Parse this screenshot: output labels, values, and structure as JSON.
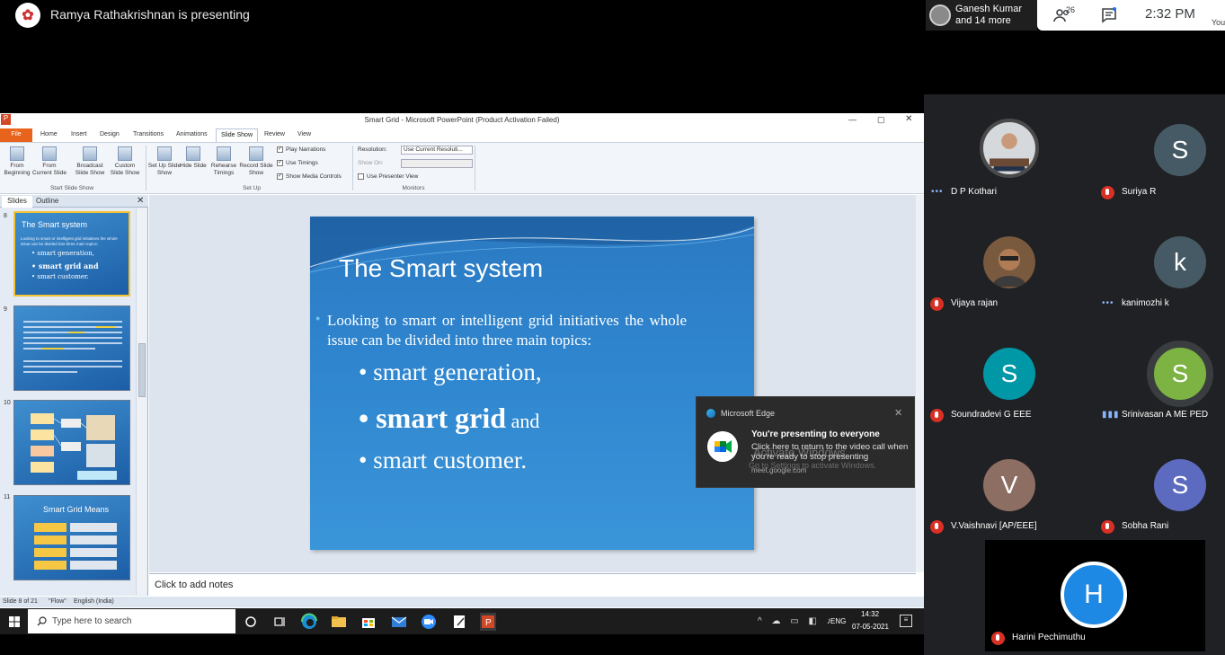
{
  "meet": {
    "presenter_text": "Ramya Rathakrishnan is presenting",
    "chip_line1": "Ganesh Kumar",
    "chip_line2": "and 14 more",
    "people_count": "26",
    "clock": "2:32 PM",
    "you_label": "You"
  },
  "powerpoint": {
    "title": "Smart Grid - Microsoft PowerPoint (Product Activation Failed)",
    "menu": [
      "File",
      "Home",
      "Insert",
      "Design",
      "Transitions",
      "Animations",
      "Slide Show",
      "Review",
      "View"
    ],
    "ribbon": {
      "from_beginning": "From Beginning",
      "from_current": "From Current Slide",
      "broadcast": "Broadcast Slide Show",
      "custom": "Custom Slide Show",
      "group_start": "Start Slide Show",
      "setup": "Set Up Slide Show",
      "hide": "Hide Slide",
      "rehearse": "Rehearse Timings",
      "record": "Record Slide Show",
      "group_setup": "Set Up",
      "play_narrations": "Play Narrations",
      "use_timings": "Use Timings",
      "show_media": "Show Media Controls",
      "resolution_label": "Resolution:",
      "resolution_value": "Use Current Resoluti...",
      "show_on": "Show On:",
      "presenter_view": "Use Presenter View",
      "group_monitors": "Monitors"
    },
    "panel": {
      "tab_slides": "Slides",
      "tab_outline": "Outline",
      "thumb8_num": "8",
      "thumb8_title": "The Smart system",
      "thumb8_text": "Looking to smart or intelligent grid initiatives the whole issue can be divided into three main topics:",
      "thumb8_b1": "• smart generation,",
      "thumb8_b2": "• smart grid and",
      "thumb8_b3": "• smart customer.",
      "thumb9_num": "9",
      "thumb10_num": "10",
      "thumb11_num": "11",
      "thumb11_title": "Smart Grid Means"
    },
    "slide": {
      "title": "The Smart system",
      "main": "Looking to smart or intelligent grid initiatives the whole issue can be divided into three main topics:",
      "sub1": "• smart generation,",
      "sub2": "• smart grid",
      "sub2_and": " and",
      "sub3": "• smart customer."
    },
    "notes_placeholder": "Click to add notes",
    "status": {
      "slide": "Slide 8 of 21",
      "theme": "\"Flow\"",
      "language": "English (India)"
    }
  },
  "taskbar": {
    "search_placeholder": "Type here to search",
    "language": "ENG",
    "time": "14:32",
    "date": "07-05-2021"
  },
  "toast": {
    "app": "Microsoft Edge",
    "title": "You're presenting to everyone",
    "body": "Click here to return to the video call when you're ready to stop presenting",
    "url": "meet.google.com",
    "watermark1": "Activate Windows",
    "watermark2": "Go to Settings to activate Windows."
  },
  "participants": [
    {
      "name": "D P Kothari",
      "initial": "",
      "color": "#6b7a8a",
      "muted": false
    },
    {
      "name": "Suriya R",
      "initial": "S",
      "color": "#455a64",
      "muted": true
    },
    {
      "name": "Vijaya rajan",
      "initial": "",
      "color": "#8a6a4a",
      "muted": true
    },
    {
      "name": "kanimozhi k",
      "initial": "k",
      "color": "#455a64",
      "muted": false
    },
    {
      "name": "Soundradevi G EEE",
      "initial": "S",
      "color": "#0097a7",
      "muted": true
    },
    {
      "name": "Srinivasan A ME PED",
      "initial": "S",
      "color": "#7cb342",
      "muted": false
    },
    {
      "name": "V.Vaishnavi [AP/EEE]",
      "initial": "V",
      "color": "#8d6e63",
      "muted": true
    },
    {
      "name": "Sobha Rani",
      "initial": "S",
      "color": "#5c6bc0",
      "muted": true
    },
    {
      "name": "Harini Pechimuthu",
      "initial": "H",
      "color": "#1e88e5",
      "muted": true
    }
  ]
}
